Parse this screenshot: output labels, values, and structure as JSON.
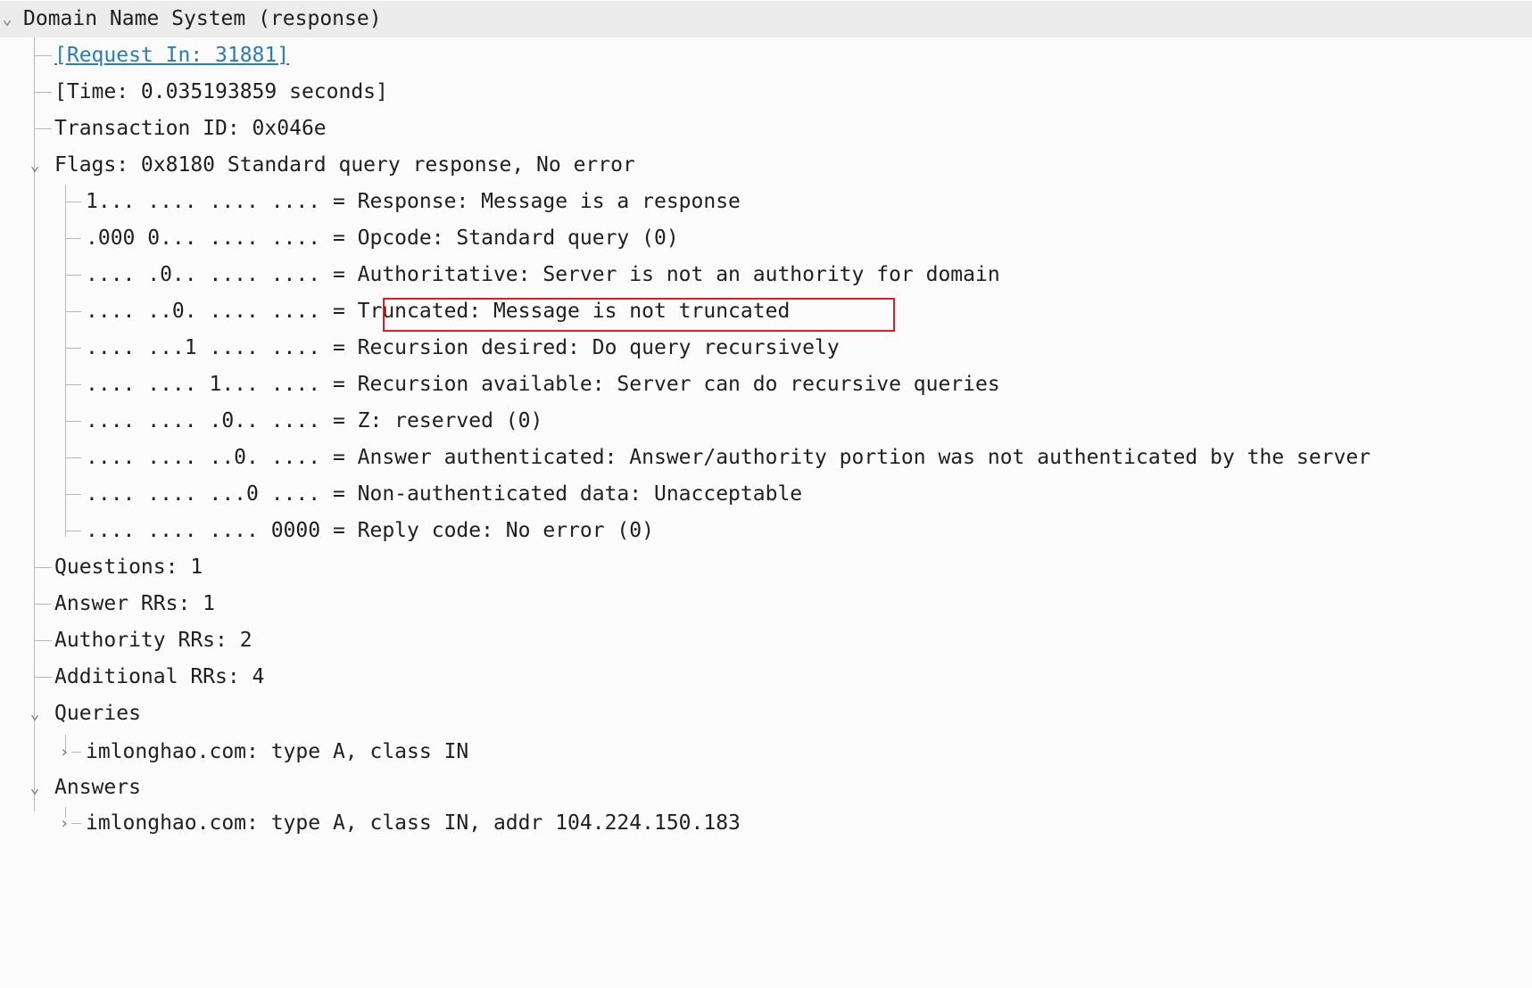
{
  "tree": {
    "root": {
      "label": "Domain Name System (response)"
    },
    "request_in": {
      "label": "[Request In: 31881]"
    },
    "time": {
      "label": "[Time: 0.035193859 seconds]"
    },
    "transaction_id": {
      "label": "Transaction ID: 0x046e"
    },
    "flags": {
      "label": "Flags: 0x8180 Standard query response, No error",
      "items": [
        "1... .... .... .... = Response: Message is a response",
        ".000 0... .... .... = Opcode: Standard query (0)",
        ".... .0.. .... .... = Authoritative: Server is not an authority for domain",
        ".... ..0. .... .... = Truncated: Message is not truncated",
        ".... ...1 .... .... = Recursion desired: Do query recursively",
        ".... .... 1... .... = Recursion available: Server can do recursive queries",
        ".... .... .0.. .... = Z: reserved (0)",
        ".... .... ..0. .... = Answer authenticated: Answer/authority portion was not authenticated by the server",
        ".... .... ...0 .... = Non-authenticated data: Unacceptable",
        ".... .... .... 0000 = Reply code: No error (0)"
      ]
    },
    "questions": {
      "label": "Questions: 1"
    },
    "answer_rrs": {
      "label": "Answer RRs: 1"
    },
    "authority_rrs": {
      "label": "Authority RRs: 2"
    },
    "additional_rrs": {
      "label": "Additional RRs: 4"
    },
    "queries": {
      "label": "Queries",
      "items": [
        "imlonghao.com: type A, class IN"
      ]
    },
    "answers": {
      "label": "Answers",
      "items": [
        "imlonghao.com: type A, class IN, addr 104.224.150.183"
      ]
    }
  },
  "icons": {
    "expanded": "chevron-down-icon",
    "collapsed": "chevron-right-icon"
  },
  "colors": {
    "link": "#2b7bb9",
    "highlight": "#e02020",
    "tree_line": "#b8b8b8",
    "selected_row": "#ececec"
  }
}
